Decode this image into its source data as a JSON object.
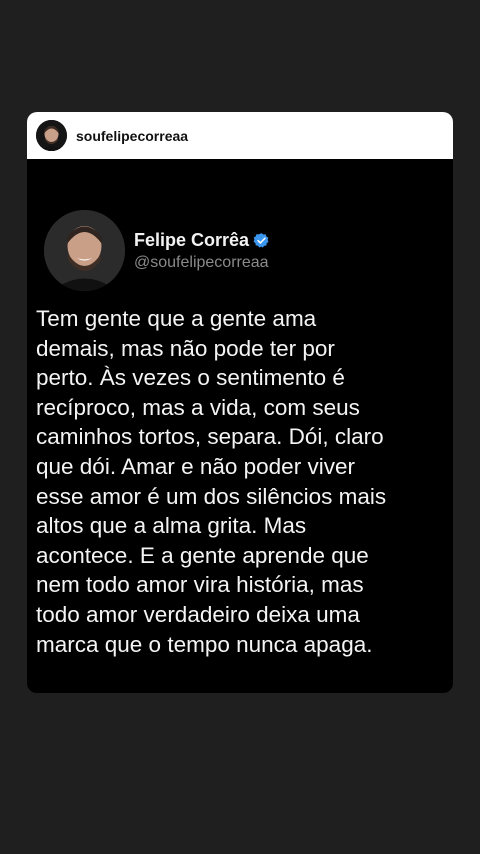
{
  "header": {
    "username": "soufelipecorreaa",
    "avatar_icon": "avatar-icon"
  },
  "post": {
    "display_name": "Felipe Corrêa",
    "handle": "@soufelipecorreaa",
    "verified_icon": "verified-badge-icon",
    "verified_color": "#3b96f0",
    "lines": [
      "Tem gente que a gente ama",
      "demais, mas não pode ter por",
      "perto. Às vezes o sentimento é",
      "recíproco, mas a vida, com seus",
      "caminhos tortos, separa. Dói, claro",
      "que dói. Amar e não poder viver",
      "esse amor é um dos silêncios mais",
      "altos que a alma grita. Mas",
      "acontece. E a gente aprende que",
      "nem todo amor vira história, mas",
      "todo amor verdadeiro deixa uma",
      "marca que o tempo nunca apaga."
    ]
  }
}
